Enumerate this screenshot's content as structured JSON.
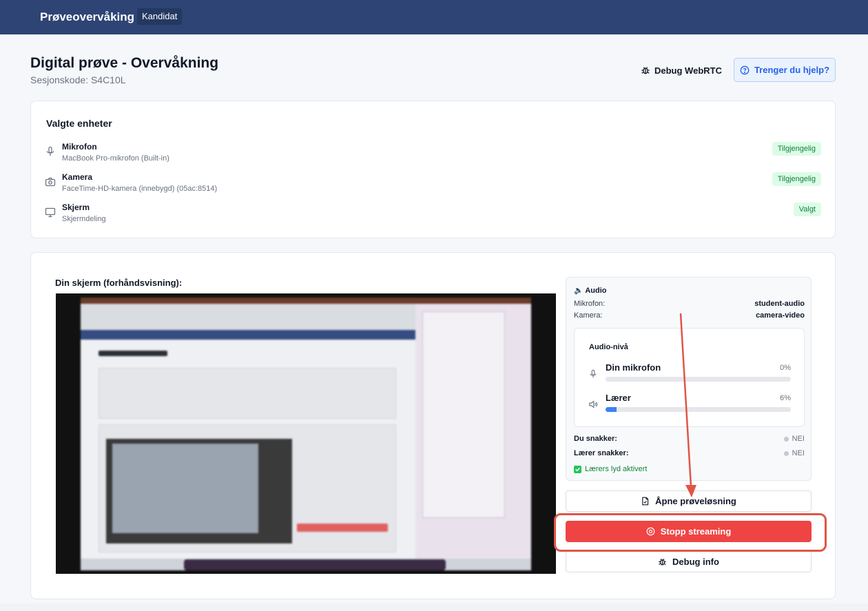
{
  "header": {
    "brand": "Prøveovervåking",
    "role": "Kandidat"
  },
  "page": {
    "title": "Digital prøve - Overvåkning",
    "session": "Sesjonskode: S4C10L",
    "debug_webrtc": "Debug WebRTC",
    "help": "Trenger du hjelp?"
  },
  "devices": {
    "title": "Valgte enheter",
    "items": [
      {
        "name": "Mikrofon",
        "detail": "MacBook Pro-mikrofon (Built-in)",
        "status": "Tilgjengelig",
        "icon": "microphone-icon"
      },
      {
        "name": "Kamera",
        "detail": "FaceTime-HD-kamera (innebygd) (05ac:8514)",
        "status": "Tilgjengelig",
        "icon": "camera-icon"
      },
      {
        "name": "Skjerm",
        "detail": "Skjermdeling",
        "status": "Valgt",
        "icon": "monitor-icon"
      }
    ]
  },
  "preview": {
    "label": "Din skjerm (forhåndsvisning):"
  },
  "audio": {
    "title": "🔈 Audio",
    "mic_label": "Mikrofon:",
    "mic_value": "student-audio",
    "cam_label": "Kamera:",
    "cam_value": "camera-video",
    "levels": {
      "title": "Audio-nivå",
      "mine": {
        "name": "Din mikrofon",
        "pct_text": "0%",
        "level": 0
      },
      "teacher": {
        "name": "Lærer",
        "pct_text": "6%",
        "level": 6
      }
    },
    "you_speak_label": "Du snakker:",
    "you_speak_value": "NEI",
    "teacher_speak_label": "Lærer snakker:",
    "teacher_speak_value": "NEI",
    "teacher_audio_on": "Lærers lyd aktivert"
  },
  "actions": {
    "open_solution": "Åpne prøveløsning",
    "stop_streaming": "Stopp streaming",
    "debug_info": "Debug info"
  },
  "colors": {
    "header": "#2d4475",
    "accent": "#2563eb",
    "danger": "#ef4444",
    "success": "#15803d",
    "annotation": "#e05546"
  }
}
